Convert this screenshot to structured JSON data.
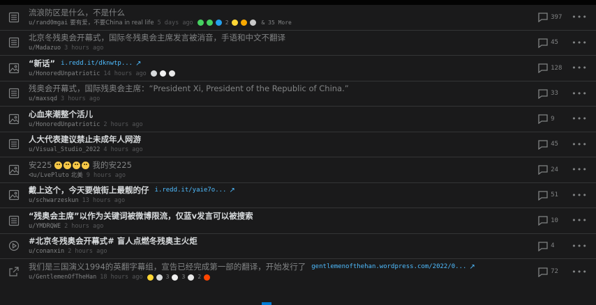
{
  "colors": {
    "background": "#1a1a1b",
    "divider": "#343536",
    "muted": "#818384",
    "link": "#4fbcff",
    "accent": "#0079d3"
  },
  "posts": [
    {
      "type": "text",
      "icon": "text-post-icon",
      "title": "流浪防区是什么，不是什么",
      "read": true,
      "author": "u/rand0mgai",
      "flair": "要有爱，不要China in real life",
      "time": "5 days ago",
      "awards": [
        {
          "c": "#46d160"
        },
        {
          "c": "#46d160",
          "shape": "pin"
        },
        {
          "c": "#24a0ed",
          "n": "2"
        },
        {
          "c": "#ffd635"
        },
        {
          "c": "#f7a800"
        },
        {
          "c": "#c9c9c9"
        }
      ],
      "more": "& 35 More",
      "comments": "397"
    },
    {
      "type": "text",
      "icon": "text-post-icon",
      "title": "北京冬残奥会开幕式，国际冬残奥会主席发言被消音，手语和中文不翻译",
      "read": true,
      "author": "u/Madazuo",
      "flair": "",
      "time": "3 hours ago",
      "awards": [],
      "more": "",
      "comments": "45"
    },
    {
      "type": "image",
      "icon": "image-post-icon",
      "title": "“新话”",
      "read": false,
      "link": "i.redd.it/dknwtp...",
      "author": "u/HonoredUnpatriotic",
      "flair": "",
      "time": "14 hours ago",
      "awards": [
        {
          "c": "#d7dadc"
        },
        {
          "c": "#f0f0f0"
        },
        {
          "c": "#e8e8e8"
        }
      ],
      "more": "",
      "comments": "128"
    },
    {
      "type": "text",
      "icon": "text-post-icon",
      "title": "残奥会开幕式，国际残奥会主席：“President Xi, President of the Republic of China.”",
      "read": true,
      "author": "u/maxsqd",
      "flair": "",
      "time": "3 hours ago",
      "awards": [],
      "more": "",
      "comments": "33"
    },
    {
      "type": "image",
      "icon": "image-post-icon",
      "title": "心血来潮整个活儿",
      "read": false,
      "author": "u/HonoredUnpatriotic",
      "flair": "",
      "time": "2 hours ago",
      "awards": [],
      "more": "",
      "comments": "9"
    },
    {
      "type": "text",
      "icon": "text-post-icon",
      "title": "人大代表建议禁止未成年人网游",
      "read": false,
      "author": "u/Visual_Studio_2022",
      "flair": "",
      "time": "4 hours ago",
      "awards": [],
      "more": "",
      "comments": "45"
    },
    {
      "type": "image",
      "icon": "image-post-icon",
      "title": "安225",
      "title_suffix": "我的安225",
      "emoji_count": 4,
      "read": true,
      "author": "u/LvePluto",
      "author_prefix": "ᐊ",
      "flair": "北美",
      "time": "9 hours ago",
      "awards": [],
      "more": "",
      "comments": "24"
    },
    {
      "type": "image",
      "icon": "image-post-icon",
      "title": "戴上这个，今天要做街上最靓的仔",
      "read": false,
      "link": "i.redd.it/yaie7o...",
      "author": "u/schwarzeskun",
      "flair": "",
      "time": "13 hours ago",
      "awards": [],
      "more": "",
      "comments": "51"
    },
    {
      "type": "text",
      "icon": "text-post-icon",
      "title": "“残奥会主席”以作为关键词被微博限流，仅蓝v发言可以被搜索",
      "read": false,
      "author": "u/YMDRQWE",
      "flair": "",
      "time": "2 hours ago",
      "awards": [],
      "more": "",
      "comments": "10"
    },
    {
      "type": "video",
      "icon": "video-post-icon",
      "title": "#北京冬残奥会开幕式# 盲人点燃冬残奥主火炬",
      "read": false,
      "author": "u/conanxin",
      "flair": "",
      "time": "2 hours ago",
      "awards": [],
      "more": "",
      "comments": "4"
    },
    {
      "type": "link",
      "icon": "link-post-icon",
      "title": "我们是三国演义1994的英翻字幕组，宣告已经完成第一部的翻译，开始发行了",
      "read": true,
      "link": "gentlemenofthehan.wordpress.com/2022/0...",
      "author": "u/GentlemenOfTheHan",
      "flair": "",
      "time": "18 hours ago",
      "awards": [
        {
          "c": "#ffd635"
        },
        {
          "c": "#d7dadc",
          "n": "3"
        },
        {
          "c": "#f0f0f0",
          "n": "3"
        },
        {
          "c": "#e8e8e8",
          "n": "2"
        },
        {
          "c": "#ff4500"
        }
      ],
      "more": "",
      "comments": "72"
    }
  ]
}
